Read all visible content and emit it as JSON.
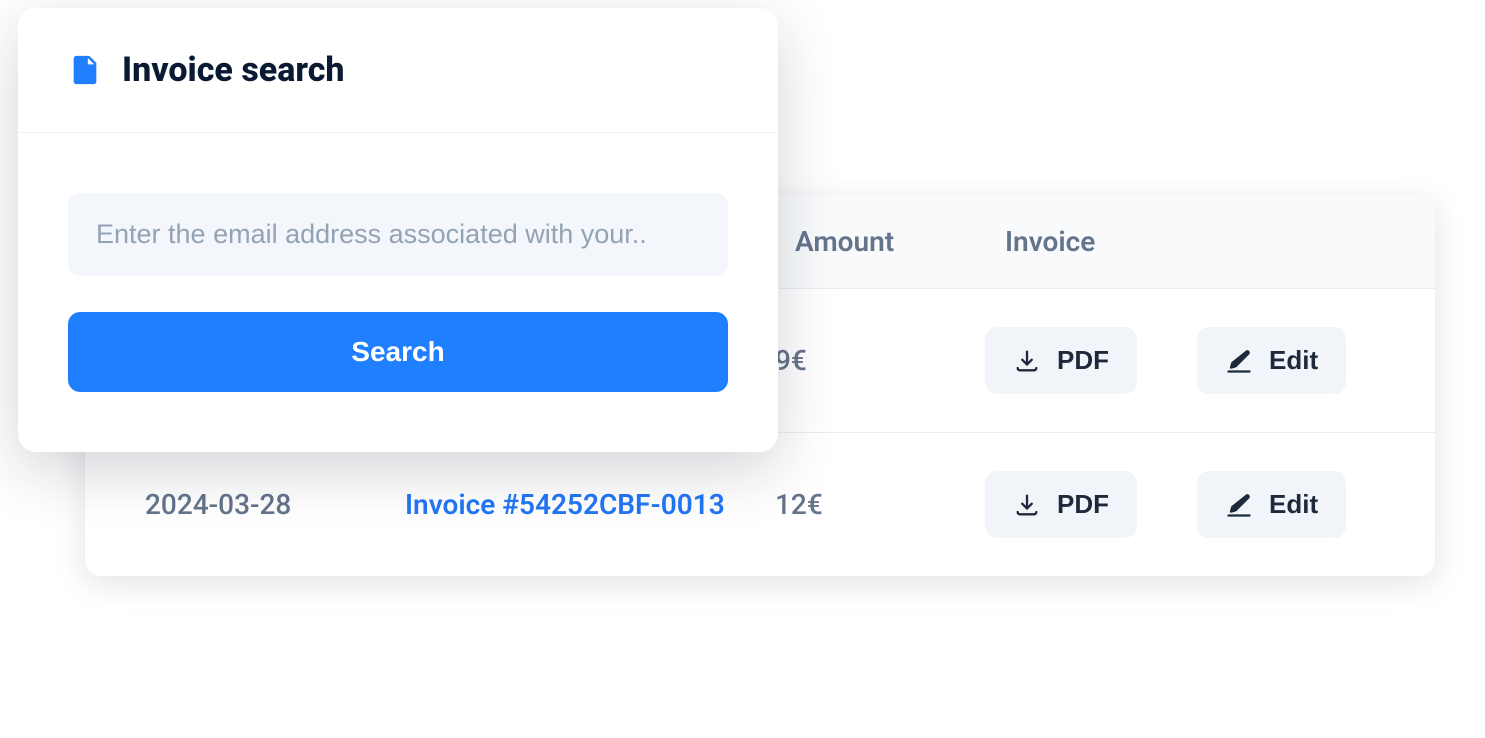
{
  "search": {
    "title": "Invoice search",
    "placeholder": "Enter the email address associated with your..",
    "button_label": "Search"
  },
  "table": {
    "headers": {
      "amount": "Amount",
      "invoice": "Invoice"
    },
    "pdf_label": "PDF",
    "edit_label": "Edit",
    "rows": [
      {
        "date": "",
        "name": "",
        "amount": "9€"
      },
      {
        "date": "2024-03-28",
        "name": "Invoice #54252CBF-0013",
        "amount": "12€"
      }
    ]
  }
}
